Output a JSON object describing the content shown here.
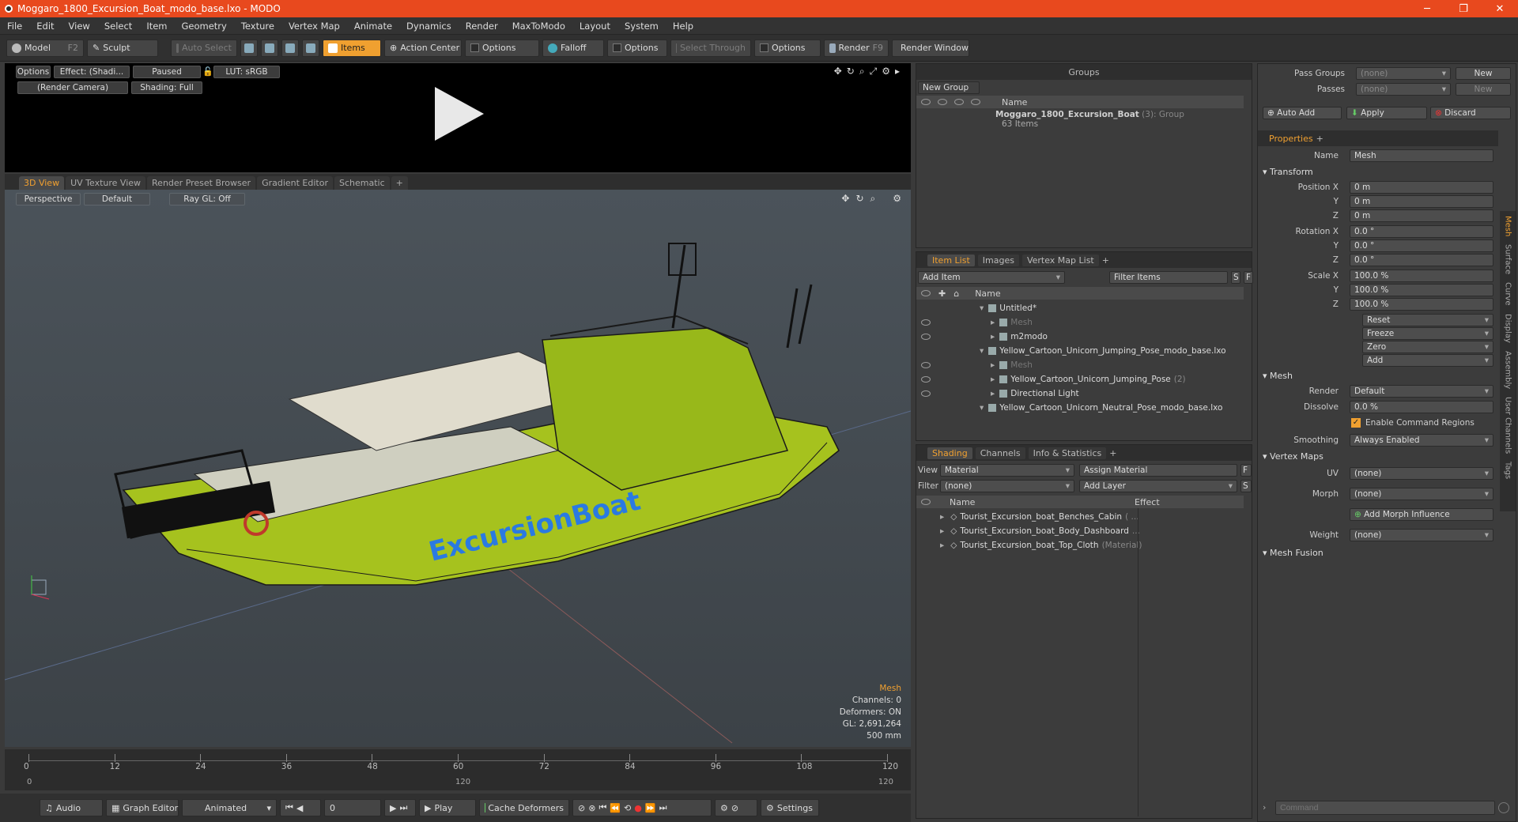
{
  "title": "Moggaro_1800_Excursion_Boat_modo_base.lxo - MODO",
  "menu": [
    "File",
    "Edit",
    "View",
    "Select",
    "Item",
    "Geometry",
    "Texture",
    "Vertex Map",
    "Animate",
    "Dynamics",
    "Render",
    "MaxToModo",
    "Layout",
    "System",
    "Help"
  ],
  "toolbar": {
    "model": "Model",
    "model_key": "F2",
    "sculpt": "Sculpt",
    "auto_select": "Auto Select",
    "items": "Items",
    "action_center": "Action Center",
    "options1": "Options",
    "falloff": "Falloff",
    "options2": "Options",
    "select_through": "Select Through",
    "options3": "Options",
    "render": "Render",
    "render_key": "F9",
    "render_window": "Render Window"
  },
  "preview": {
    "options": "Options",
    "effect": "Effect: (Shadi...",
    "paused": "Paused",
    "lut": "LUT: sRGB",
    "camera": "(Render Camera)",
    "shading": "Shading: Full"
  },
  "view_tabs": [
    "3D View",
    "UV Texture View",
    "Render Preset Browser",
    "Gradient Editor",
    "Schematic",
    "+"
  ],
  "viewport": {
    "perspective": "Perspective",
    "default": "Default",
    "raygl": "Ray GL: Off",
    "info": {
      "mesh": "Mesh",
      "channels": "Channels: 0",
      "deformers": "Deformers: ON",
      "gl": "GL: 2,691,264",
      "size": "500 mm"
    },
    "hull_text": "ExcursionBoat"
  },
  "timeline": {
    "ticks": [
      "0",
      "12",
      "24",
      "36",
      "48",
      "60",
      "72",
      "84",
      "96",
      "108",
      "120"
    ],
    "start": "0",
    "end": "120"
  },
  "bottombar": {
    "audio": "Audio",
    "graph_editor": "Graph Editor",
    "animated": "Animated",
    "frame": "0",
    "play": "Play",
    "cache": "Cache Deformers",
    "settings": "Settings"
  },
  "groups": {
    "header": "Groups",
    "new_group": "New Group",
    "name_col": "Name",
    "item_name": "Moggaro_1800_Excursion_Boat",
    "item_count": "(3)",
    "item_type": ": Group",
    "item_sub": "63 Items"
  },
  "itemlist": {
    "tabs": [
      "Item List",
      "Images",
      "Vertex Map List",
      "+"
    ],
    "add_item": "Add Item",
    "filter": "Filter Items",
    "s": "S",
    "f": "F",
    "name_col": "Name",
    "items": [
      {
        "label": "Untitled*",
        "indent": 0,
        "dim": false
      },
      {
        "label": "Mesh",
        "indent": 1,
        "dim": true
      },
      {
        "label": "m2modo",
        "indent": 1,
        "dim": false
      },
      {
        "label": "Yellow_Cartoon_Unicorn_Jumping_Pose_modo_base.lxo",
        "indent": 0,
        "dim": false
      },
      {
        "label": "Mesh",
        "indent": 1,
        "dim": true
      },
      {
        "label": "Yellow_Cartoon_Unicorn_Jumping_Pose",
        "indent": 1,
        "dim": false,
        "count": "(2)"
      },
      {
        "label": "Directional Light",
        "indent": 1,
        "dim": false
      },
      {
        "label": "Yellow_Cartoon_Unicorn_Neutral_Pose_modo_base.lxo",
        "indent": 0,
        "dim": false
      }
    ]
  },
  "shading": {
    "tabs": [
      "Shading",
      "Channels",
      "Info & Statistics",
      "+"
    ],
    "view_label": "View",
    "view_value": "Material",
    "assign": "Assign Material",
    "f": "F",
    "filter_label": "Filter",
    "filter_value": "(none)",
    "add_layer": "Add Layer",
    "s": "S",
    "name_col": "Name",
    "effect_col": "Effect",
    "items": [
      {
        "label": "Tourist_Excursion_boat_Benches_Cabin",
        "suffix": "( ..."
      },
      {
        "label": "Tourist_Excursion_boat_Body_Dashboard",
        "suffix": "..."
      },
      {
        "label": "Tourist_Excursion_boat_Top_Cloth",
        "suffix": "(Material)"
      }
    ]
  },
  "passes": {
    "pass_groups": "Pass Groups",
    "passes": "Passes",
    "none1": "(none)",
    "none2": "(none)",
    "new1": "New",
    "new2": "New"
  },
  "actions": {
    "auto_add": "Auto Add",
    "apply": "Apply",
    "discard": "Discard"
  },
  "properties": {
    "tab": "Properties",
    "plus": "+",
    "name_label": "Name",
    "name_value": "Mesh",
    "transform": "Transform",
    "position_label": "Position X",
    "pos": [
      "0 m",
      "0 m",
      "0 m"
    ],
    "rotation_label": "Rotation X",
    "rot": [
      "0.0 °",
      "0.0 °",
      "0.0 °"
    ],
    "scale_label": "Scale X",
    "scale": [
      "100.0 %",
      "100.0 %",
      "100.0 %"
    ],
    "y": "Y",
    "z": "Z",
    "reset": "Reset",
    "freeze": "Freeze",
    "zero": "Zero",
    "add": "Add",
    "mesh": "Mesh",
    "render_label": "Render",
    "render_value": "Default",
    "dissolve_label": "Dissolve",
    "dissolve_value": "0.0 %",
    "enable_cmd": "Enable Command Regions",
    "smoothing_label": "Smoothing",
    "smoothing_value": "Always Enabled",
    "vertex_maps": "Vertex Maps",
    "uv_label": "UV",
    "uv_value": "(none)",
    "morph_label": "Morph",
    "morph_value": "(none)",
    "add_morph": "Add Morph Influence",
    "weight_label": "Weight",
    "weight_value": "(none)",
    "mesh_fusion": "Mesh Fusion",
    "side_tabs": [
      "Mesh",
      "Surface",
      "Curve",
      "Display",
      "Assembly",
      "User Channels",
      "Tags"
    ]
  },
  "command": {
    "placeholder": "Command"
  },
  "colors": {
    "accent": "#f0a030",
    "titlebar": "#e8491e",
    "hull": "#a6c21e"
  }
}
